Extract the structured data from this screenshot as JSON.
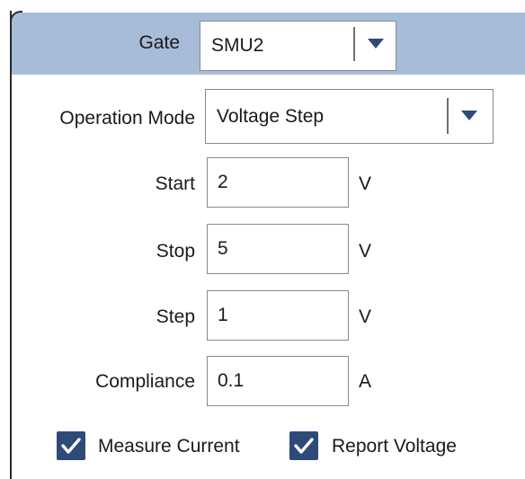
{
  "gate": {
    "label": "Gate",
    "value": "SMU2",
    "caret_icon": "chevron-down-icon"
  },
  "operation_mode": {
    "label": "Operation Mode",
    "value": "Voltage Step",
    "caret_icon": "chevron-down-icon"
  },
  "fields": [
    {
      "label": "Start",
      "value": "2",
      "unit": "V"
    },
    {
      "label": "Stop",
      "value": "5",
      "unit": "V"
    },
    {
      "label": "Step",
      "value": "1",
      "unit": "V"
    },
    {
      "label": "Compliance",
      "value": "0.1",
      "unit": "A"
    }
  ],
  "options": [
    {
      "label": "Measure Current",
      "checked": true,
      "icon": "checkmark-icon"
    },
    {
      "label": "Report Voltage",
      "checked": true,
      "icon": "checkmark-icon"
    }
  ],
  "colors": {
    "header_bg": "#a7bcd8",
    "accent": "#2e4a78",
    "border": "#8a8a8a"
  }
}
